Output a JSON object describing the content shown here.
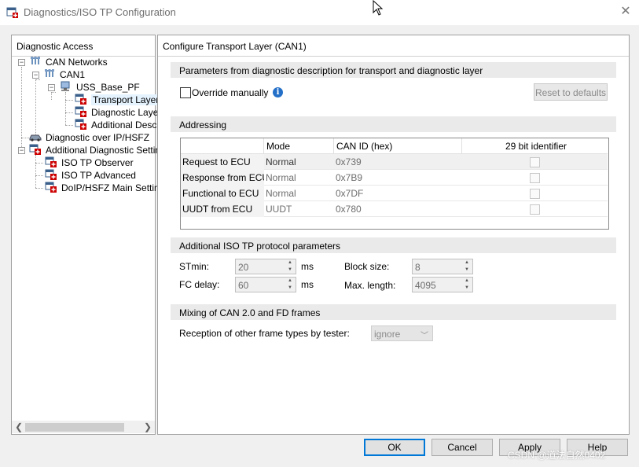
{
  "window": {
    "title": "Diagnostics/ISO TP Configuration",
    "close_glyph": "✕"
  },
  "left_panel": {
    "header": "Diagnostic Access",
    "tree": [
      {
        "label": "CAN Networks",
        "icon": "network-icon",
        "expanded": true
      },
      {
        "label": "CAN1",
        "icon": "network-icon",
        "expanded": true
      },
      {
        "label": "USS_Base_PF",
        "icon": "computer-icon",
        "expanded": true
      },
      {
        "label": "Transport Layer",
        "icon": "config-icon",
        "selected": true
      },
      {
        "label": "Diagnostic Layer",
        "icon": "config-icon"
      },
      {
        "label": "Additional Descri",
        "icon": "config-icon"
      },
      {
        "label": "Diagnostic over IP/HSFZ",
        "icon": "car-icon"
      },
      {
        "label": "Additional Diagnostic Settings",
        "icon": "config-icon",
        "expanded": true
      },
      {
        "label": "ISO TP Observer",
        "icon": "config-icon"
      },
      {
        "label": "ISO TP Advanced",
        "icon": "config-icon"
      },
      {
        "label": "DoIP/HSFZ Main Setting",
        "icon": "config-icon"
      }
    ]
  },
  "right_panel": {
    "header": "Configure Transport Layer (CAN1)",
    "params_section": {
      "title": "Parameters from diagnostic description for transport and diagnostic layer",
      "override_label": "Override manually",
      "override_checked": false,
      "reset_label": "Reset to defaults"
    },
    "addressing_section": {
      "title": "Addressing",
      "columns": [
        "Mode",
        "CAN ID (hex)",
        "29 bit identifier"
      ],
      "rows": [
        {
          "name": "Request to ECU",
          "mode": "Normal",
          "can_id": "0x739",
          "bit29": false
        },
        {
          "name": "Response from ECU",
          "mode": "Normal",
          "can_id": "0x7B9",
          "bit29": false
        },
        {
          "name": "Functional to ECU",
          "mode": "Normal",
          "can_id": "0x7DF",
          "bit29": false
        },
        {
          "name": "UUDT from ECU",
          "mode": "UUDT",
          "can_id": "0x780",
          "bit29": false
        }
      ]
    },
    "isotp_section": {
      "title": "Additional ISO TP protocol parameters",
      "stmin_label": "STmin:",
      "stmin_value": "20",
      "stmin_unit": "ms",
      "fcdelay_label": "FC delay:",
      "fcdelay_value": "60",
      "fcdelay_unit": "ms",
      "blocksize_label": "Block size:",
      "blocksize_value": "8",
      "maxlen_label": "Max. length:",
      "maxlen_value": "4095"
    },
    "mixing_section": {
      "title": "Mixing of CAN 2.0 and FD frames",
      "reception_label": "Reception of other frame types by tester:",
      "reception_value": "ignore"
    }
  },
  "buttons": {
    "ok": "OK",
    "cancel": "Cancel",
    "apply": "Apply",
    "help": "Help"
  },
  "watermark": "CSDN @道法自然0402",
  "colors": {
    "accent": "#0078d7",
    "info": "#2470c8",
    "selection": "#e5f3ff"
  }
}
